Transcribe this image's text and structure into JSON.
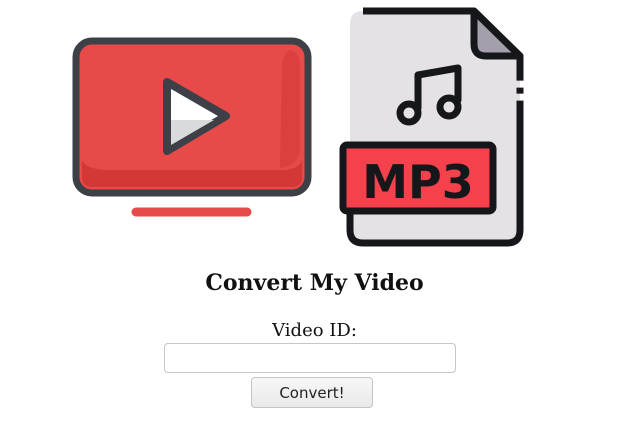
{
  "logo": {
    "icons": [
      "youtube-tv-icon",
      "mp3-file-icon"
    ],
    "mp3_badge_text": "MP3",
    "colors": {
      "red": "#e84a4a",
      "dark_red": "#d93a3a",
      "outline": "#3d4147",
      "file_fill": "#e4e2e7",
      "fold_fill": "#a39fab",
      "white": "#ffffff"
    }
  },
  "form": {
    "title": "Convert My Video",
    "label": "Video ID:",
    "input_value": "",
    "button_label": "Convert!"
  }
}
